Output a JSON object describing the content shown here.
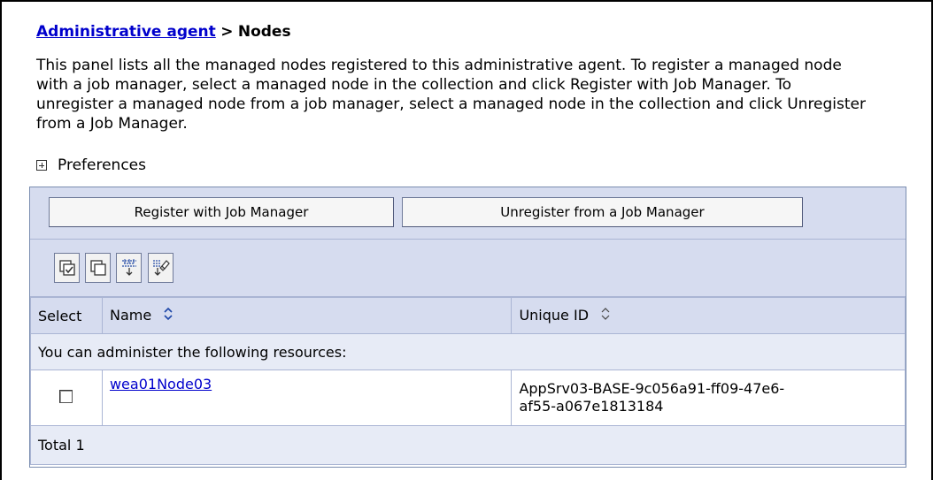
{
  "breadcrumb": {
    "parent": "Administrative agent",
    "separator": ">",
    "current": "Nodes"
  },
  "description": "This panel lists all the managed nodes registered to this administrative agent. To register a managed node with a job manager, select a managed node in the collection and click Register with Job Manager. To unregister a managed node from a job manager, select a managed node in the collection and click Unregister from a Job Manager.",
  "preferences_label": "Preferences",
  "buttons": {
    "register": "Register with Job Manager",
    "unregister": "Unregister from a Job Manager"
  },
  "icon_toolbar": [
    "select-all-icon",
    "deselect-all-icon",
    "show-filter-icon",
    "clear-filter-icon"
  ],
  "table": {
    "columns": {
      "select": "Select",
      "name": "Name",
      "unique_id": "Unique ID"
    },
    "group_label": "You can administer the following resources:",
    "rows": [
      {
        "selected": false,
        "name": "wea01Node03",
        "unique_id_line1": "AppSrv03-BASE-9c056a91-ff09-47e6-",
        "unique_id_line2": "af55-a067e1813184"
      }
    ],
    "total": "Total 1"
  },
  "colors": {
    "link": "#0000cc",
    "toolbar_bg": "#d6dcef",
    "row_bg_light": "#e7ebf6",
    "border": "#aab5d4"
  }
}
